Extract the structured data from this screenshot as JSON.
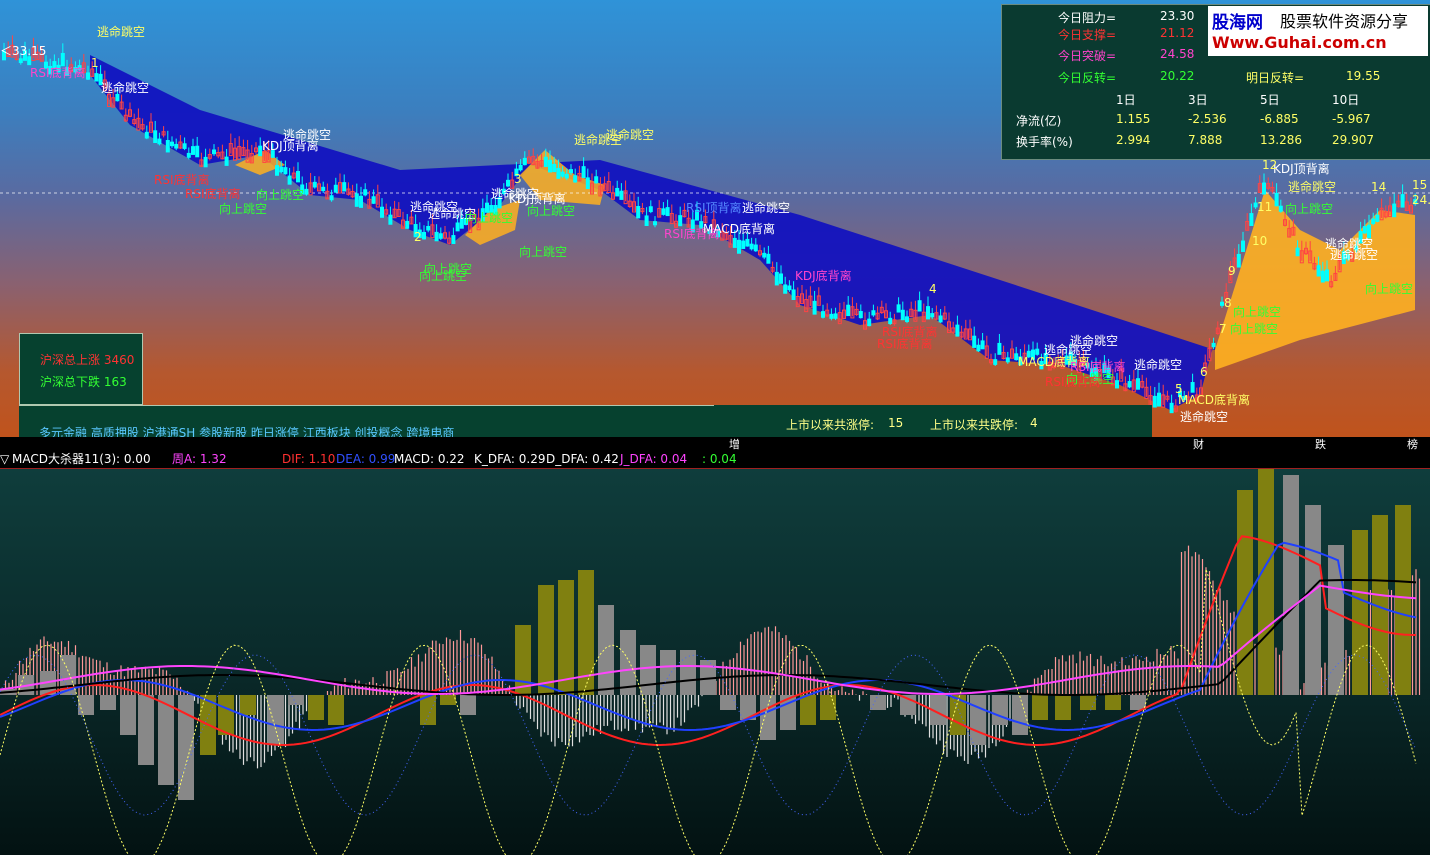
{
  "chart": {
    "price_readout": "33.15",
    "markers": [
      {
        "t": "逃命跳空",
        "c": "y"
      },
      {
        "t": "逃命跳空",
        "c": "w"
      },
      {
        "t": "RSI底背离",
        "c": "m"
      },
      {
        "t": "逃命跳空",
        "c": "w"
      },
      {
        "t": "KDJ顶背离",
        "c": "w"
      },
      {
        "t": "RSI底背离",
        "c": "r"
      },
      {
        "t": "RSI底背离",
        "c": "r"
      },
      {
        "t": "向上跳空",
        "c": "g"
      },
      {
        "t": "向上跳空",
        "c": "g"
      },
      {
        "t": "逃命跳空",
        "c": "w"
      },
      {
        "t": "逃命跳空",
        "c": "w"
      },
      {
        "t": "向上跳空",
        "c": "g"
      },
      {
        "t": "向上跳空",
        "c": "g"
      },
      {
        "t": "向上跳空",
        "c": "g"
      },
      {
        "t": "逃命跳空",
        "c": "y"
      },
      {
        "t": "逃命跳空",
        "c": "y"
      },
      {
        "t": "逃命跳空",
        "c": "w"
      },
      {
        "t": "KDJ顶背离",
        "c": "w"
      },
      {
        "t": "向上跳空",
        "c": "g"
      },
      {
        "t": "向上跳空",
        "c": "g"
      },
      {
        "t": "RSI顶背离",
        "c": "b"
      },
      {
        "t": "逃命跳空",
        "c": "w"
      },
      {
        "t": "RSI底背离",
        "c": "m"
      },
      {
        "t": "MACD底背离",
        "c": "w"
      },
      {
        "t": "KDJ底背离",
        "c": "m"
      },
      {
        "t": "RSI底背离",
        "c": "r"
      },
      {
        "t": "RSI底背离",
        "c": "r"
      },
      {
        "t": "逃命跳空",
        "c": "w"
      },
      {
        "t": "逃命跳空",
        "c": "w"
      },
      {
        "t": "MACD底背离",
        "c": "y"
      },
      {
        "t": "RSI底背离",
        "c": "m"
      },
      {
        "t": "向上跳空",
        "c": "g"
      },
      {
        "t": "RSI底背离",
        "c": "r"
      },
      {
        "t": "逃命跳空",
        "c": "w"
      },
      {
        "t": "MACD底背离",
        "c": "y"
      },
      {
        "t": "向上跳空",
        "c": "g"
      },
      {
        "t": "向上跳空",
        "c": "g"
      },
      {
        "t": "KDJ顶背离",
        "c": "w"
      },
      {
        "t": "逃命跳空",
        "c": "y"
      },
      {
        "t": "逃命跳空",
        "c": "y"
      },
      {
        "t": "向上跳空",
        "c": "g"
      },
      {
        "t": "逃命跳空",
        "c": "w"
      },
      {
        "t": "逃命跳空",
        "c": "w"
      },
      {
        "t": "向上跳空",
        "c": "g"
      },
      {
        "t": "逃命跳空",
        "c": "w"
      }
    ],
    "wave_numbers": [
      "1",
      "2",
      "3",
      "4",
      "5",
      "6",
      "7",
      "8",
      "9",
      "10",
      "11",
      "12",
      "13",
      "14",
      "15"
    ],
    "right_price": "24.3"
  },
  "stats": {
    "today_resistance_label": "今日阻力=",
    "today_resistance": "23.30",
    "today_support_label": "今日支撑=",
    "today_support": "21.12",
    "today_breakout_label": "今日突破=",
    "today_breakout": "24.58",
    "today_reversal_label": "今日反转=",
    "today_reversal": "20.22",
    "tomorrow_reversal_label": "明日反转=",
    "tomorrow_reversal": "19.55",
    "periods": [
      "1日",
      "3日",
      "5日",
      "10日"
    ],
    "net_flow_label": "净流(亿)",
    "net_flow": [
      "1.155",
      "-2.536",
      "-6.885",
      "-5.967"
    ],
    "turnover_label": "换手率(%)",
    "turnover": [
      "2.994",
      "7.888",
      "13.286",
      "29.907"
    ]
  },
  "logo": {
    "name": "股海网",
    "slogan": "股票软件资源分享",
    "url": "Www.Guhai.com.cn"
  },
  "market": {
    "up_label": "沪深总上涨",
    "up_count": "3460",
    "down_label": "沪深总下跌",
    "down_count": "163"
  },
  "concepts": "多元金融 高质押股 沪港通SH 参股新股 昨日涨停 江西板块 创投概念 跨境电商",
  "limits": {
    "up_label": "上市以来共涨停:",
    "up_count": "15",
    "down_label": "上市以来共跌停:",
    "down_count": "4"
  },
  "tags": [
    "增",
    "财",
    "跌",
    "榜"
  ],
  "indicator": {
    "name": "MACD大杀器11(3)",
    "v0": ": 0.00",
    "week_a": "周A: 1.32",
    "dif": "DIF: 1.10",
    "dea": "DEA: 0.99",
    "macd": "MACD: 0.22",
    "k": "K_DFA: 0.29",
    "d": "D_DFA: 0.42",
    "j": "J_DFA: 0.04",
    "last": ": 0.04"
  },
  "colors": {
    "up": "#ff4444",
    "down": "#00ffff",
    "cloud": "#1010c0",
    "cloud_up": "#ffb020",
    "dif": "#ff2020",
    "dea": "#2040ff",
    "ma_black": "#000000",
    "ma_pink": "#ff44ff"
  }
}
